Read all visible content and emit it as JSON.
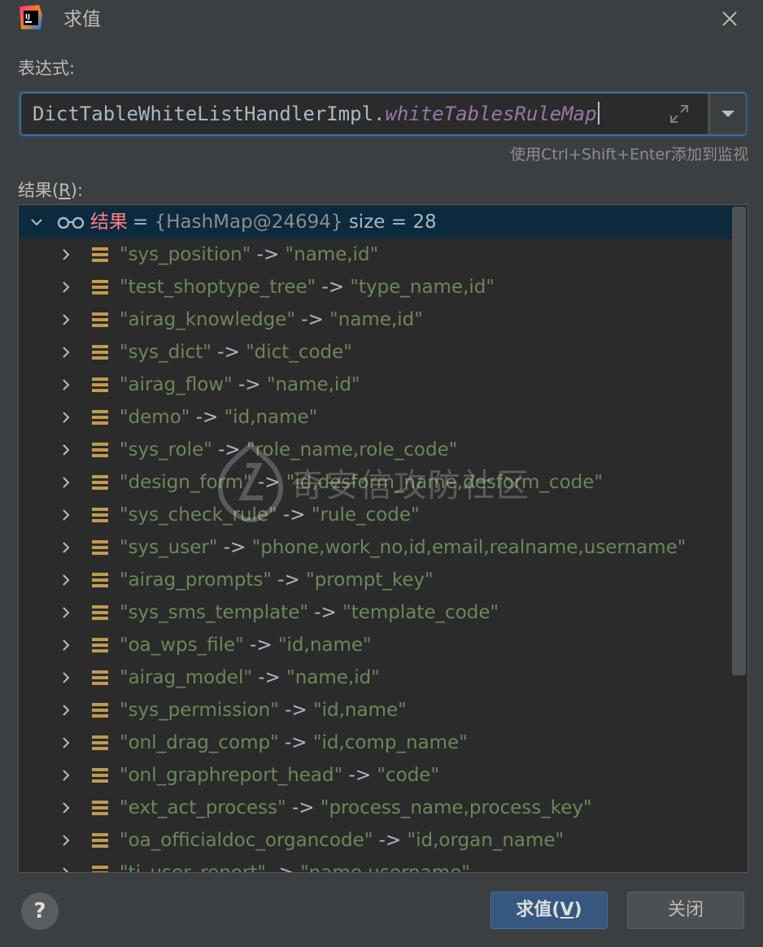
{
  "window": {
    "title": "求值",
    "logo_text": "IJ"
  },
  "expression": {
    "label": "表达式:",
    "class_part": "DictTableWhiteListHandlerImpl.",
    "field_part": "whiteTablesRuleMap",
    "hint": "使用Ctrl+Shift+Enter添加到监视"
  },
  "result": {
    "label_prefix": "结果(",
    "label_mnemonic": "R",
    "label_suffix": "):",
    "root": {
      "name": "结果",
      "equals": " = ",
      "object": "{HashMap@24694}",
      "size": "  size = 28"
    },
    "entries": [
      {
        "key": "\"sys_position\"",
        "value": "\"name,id\""
      },
      {
        "key": "\"test_shoptype_tree\"",
        "value": "\"type_name,id\""
      },
      {
        "key": "\"airag_knowledge\"",
        "value": "\"name,id\""
      },
      {
        "key": "\"sys_dict\"",
        "value": "\"dict_code\""
      },
      {
        "key": "\"airag_flow\"",
        "value": "\"name,id\""
      },
      {
        "key": "\"demo\"",
        "value": "\"id,name\""
      },
      {
        "key": "\"sys_role\"",
        "value": "\"role_name,role_code\""
      },
      {
        "key": "\"design_form\"",
        "value": "\"id,desform_name,desform_code\""
      },
      {
        "key": "\"sys_check_rule\"",
        "value": "\"rule_code\""
      },
      {
        "key": "\"sys_user\"",
        "value": "\"phone,work_no,id,email,realname,username\""
      },
      {
        "key": "\"airag_prompts\"",
        "value": "\"prompt_key\""
      },
      {
        "key": "\"sys_sms_template\"",
        "value": "\"template_code\""
      },
      {
        "key": "\"oa_wps_file\"",
        "value": "\"id,name\""
      },
      {
        "key": "\"airag_model\"",
        "value": "\"name,id\""
      },
      {
        "key": "\"sys_permission\"",
        "value": "\"id,name\""
      },
      {
        "key": "\"onl_drag_comp\"",
        "value": "\"id,comp_name\""
      },
      {
        "key": "\"onl_graphreport_head\"",
        "value": "\"code\""
      },
      {
        "key": "\"ext_act_process\"",
        "value": "\"process_name,process_key\""
      },
      {
        "key": "\"oa_officialdoc_organcode\"",
        "value": "\"id,organ_name\""
      },
      {
        "key": "\"tj_user_report\"",
        "value": "\"name,username\""
      }
    ],
    "arrow": " -> "
  },
  "watermark": {
    "text": "奇安信攻防社区"
  },
  "footer": {
    "help": "?",
    "evaluate_prefix": "求值(",
    "evaluate_mnemonic": "V",
    "evaluate_suffix": ")",
    "close": "关闭"
  },
  "colors": {
    "background": "#3c3f41",
    "editor": "#2b2b2b",
    "selection": "#0d293e",
    "string": "#6a8759",
    "field": "#9876aa",
    "root_name": "#ff8080",
    "entry_icon": "#c09a4f",
    "primary_button": "#365880"
  },
  "icons": {
    "logo": "intellij-idea-icon",
    "close": "close-icon",
    "expand": "expand-icon",
    "dropdown": "chevron-down-icon",
    "watch": "glasses-icon",
    "entry": "map-entry-icon",
    "help": "help-icon"
  }
}
